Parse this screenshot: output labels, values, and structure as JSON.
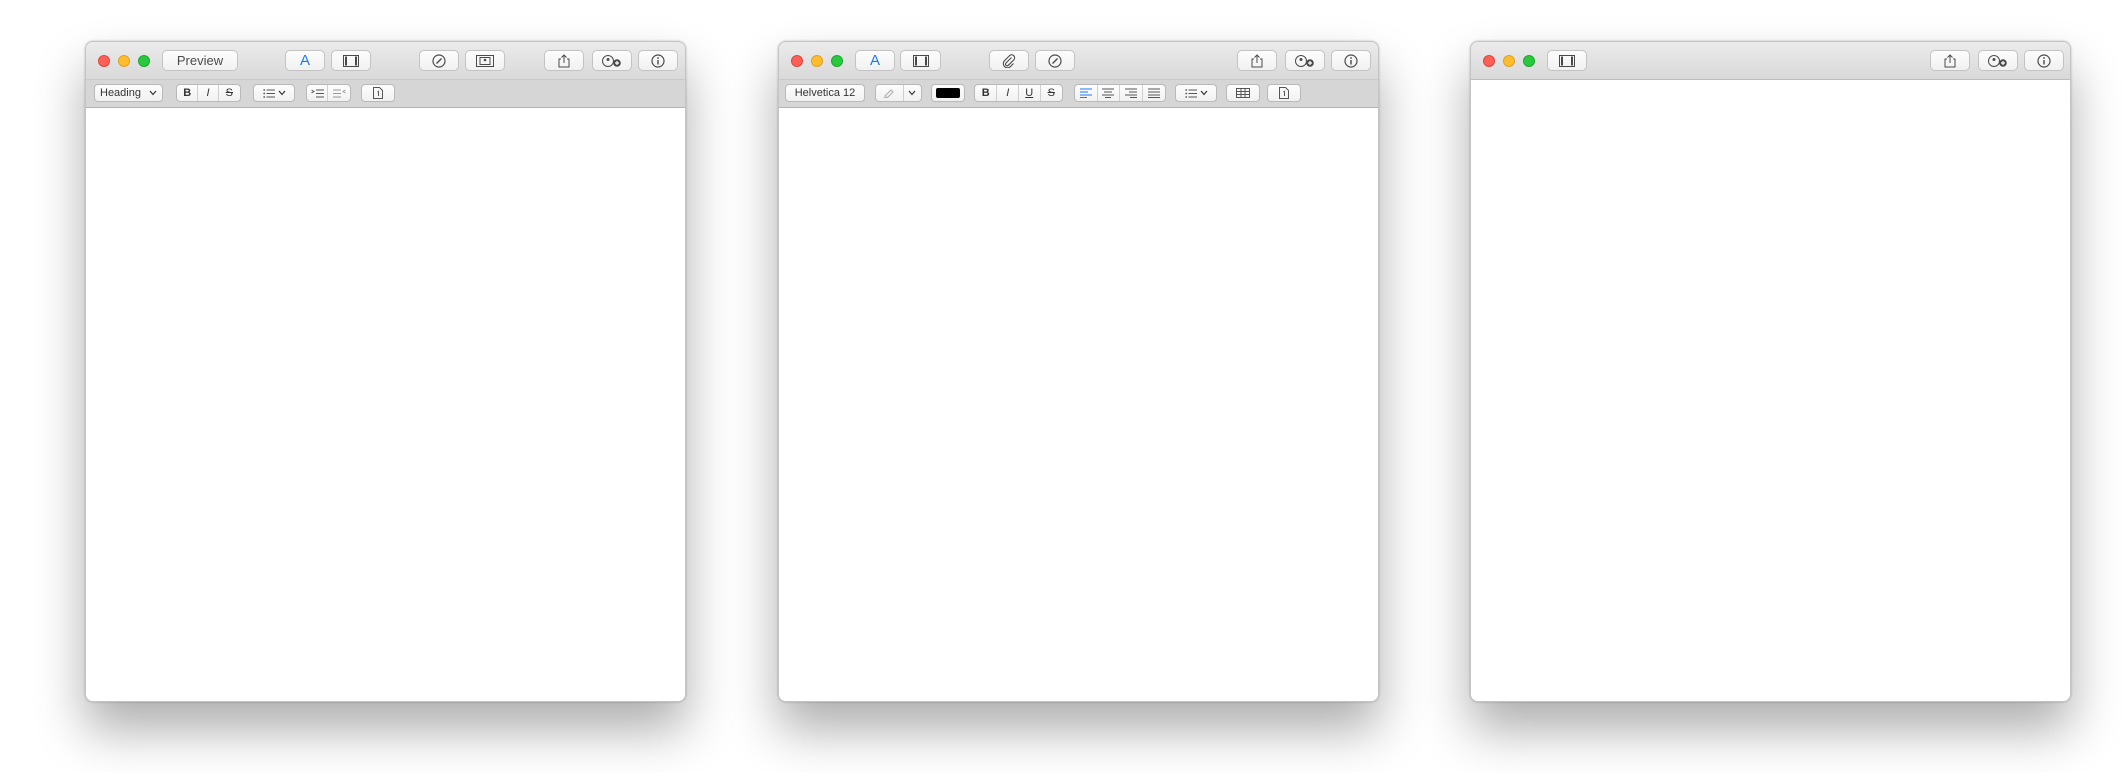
{
  "window1": {
    "preview_label": "Preview",
    "style_popup_value": "Heading",
    "format_bold": "B",
    "format_italic": "I",
    "format_strikethrough": "S",
    "toolbar_icons": [
      "format-text-icon",
      "media-browser-icon",
      "markup-icon",
      "photo-slideshow-icon",
      "share-icon",
      "collaboration-add-icon",
      "info-icon"
    ]
  },
  "window2": {
    "font_value": "Helvetica 12",
    "text_color": "#000000",
    "format_bold": "B",
    "format_italic": "I",
    "format_underline": "U",
    "format_strikethrough": "S",
    "toolbar_icons": [
      "format-text-icon",
      "media-browser-icon",
      "attachment-icon",
      "markup-icon",
      "share-icon",
      "collaboration-add-icon",
      "info-icon"
    ]
  },
  "window3": {
    "toolbar_icons": [
      "media-browser-icon",
      "share-icon",
      "collaboration-add-icon",
      "info-icon"
    ]
  },
  "colors": {
    "accent": "#1a7cf4",
    "traffic_close": "#fe5f57",
    "traffic_minimize": "#febc2e",
    "traffic_zoom": "#28c840"
  }
}
